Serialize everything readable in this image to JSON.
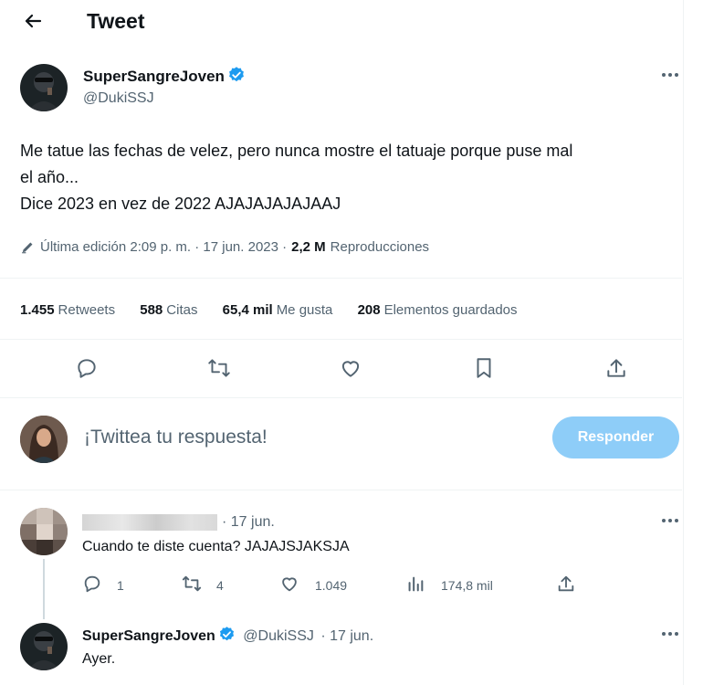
{
  "header": {
    "title": "Tweet"
  },
  "tweet": {
    "author_name": "SuperSangreJoven",
    "author_handle": "@DukiSSJ",
    "text_line1": "Me tatue las fechas de velez, pero nunca mostre el tatuaje porque puse mal",
    "text_line2": "el año...",
    "text_line3": "Dice 2023 en vez de 2022 AJAJAJAJAJAAJ",
    "edit_label": "Última edición 2:09 p. m. · 17 jun. 2023 ·",
    "views_count": "2,2 M",
    "views_label": "Reproducciones"
  },
  "stats": [
    {
      "count": "1.455",
      "label": "Retweets"
    },
    {
      "count": "588",
      "label": "Citas"
    },
    {
      "count": "65,4 mil",
      "label": "Me gusta"
    },
    {
      "count": "208",
      "label": "Elementos guardados"
    }
  ],
  "compose": {
    "placeholder": "¡Twittea tu respuesta!",
    "button": "Responder"
  },
  "reply1": {
    "date": "· 17 jun.",
    "text": "Cuando te diste cuenta? JAJAJSJAKSJA",
    "replies": "1",
    "retweets": "4",
    "likes": "1.049",
    "views": "174,8 mil"
  },
  "reply2": {
    "author_name": "SuperSangreJoven",
    "author_handle": "@DukiSSJ",
    "date": "· 17 jun.",
    "text": "Ayer."
  },
  "colors": {
    "accent": "#1d9bf0",
    "reply_button": "#8ecdf8",
    "muted": "#536471"
  }
}
